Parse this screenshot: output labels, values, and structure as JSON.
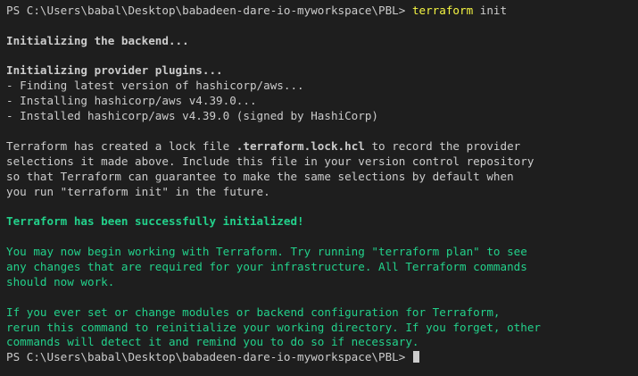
{
  "terminal": {
    "top_fragment_1": "----",
    "top_fragment_2": "-------------",
    "top_fragment_3": "------ ----",
    "prompt_path": "PS C:\\Users\\babal\\Desktop\\babadeen-dare-io-myworkspace\\PBL> ",
    "command_name": "terraform",
    "command_args": " init",
    "backend_heading": "Initializing the backend...",
    "provider_heading": "Initializing provider plugins...",
    "provider_lines": [
      "- Finding latest version of hashicorp/aws...",
      "- Installing hashicorp/aws v4.39.0...",
      "- Installed hashicorp/aws v4.39.0 (signed by HashiCorp)"
    ],
    "lock_line_1_pre": "Terraform has created a lock file ",
    "lock_filename": ".terraform.lock.hcl",
    "lock_line_1_post": " to record the provider",
    "lock_lines_rest": [
      "selections it made above. Include this file in your version control repository",
      "so that Terraform can guarantee to make the same selections by default when",
      "you run \"terraform init\" in the future."
    ],
    "success_message": "Terraform has been successfully initialized!",
    "begin_lines": [
      "You may now begin working with Terraform. Try running \"terraform plan\" to see",
      "any changes that are required for your infrastructure. All Terraform commands",
      "should now work."
    ],
    "reinit_lines": [
      "If you ever set or change modules or backend configuration for Terraform,",
      "rerun this command to reinitialize your working directory. If you forget, other",
      "commands will detect it and remind you to do so if necessary."
    ],
    "final_prompt": "PS C:\\Users\\babal\\Desktop\\babadeen-dare-io-myworkspace\\PBL> ",
    "colors": {
      "background": "#1e1e1e",
      "text": "#cccccc",
      "success_green": "#23d18b",
      "command_yellow": "#f5f543"
    }
  }
}
